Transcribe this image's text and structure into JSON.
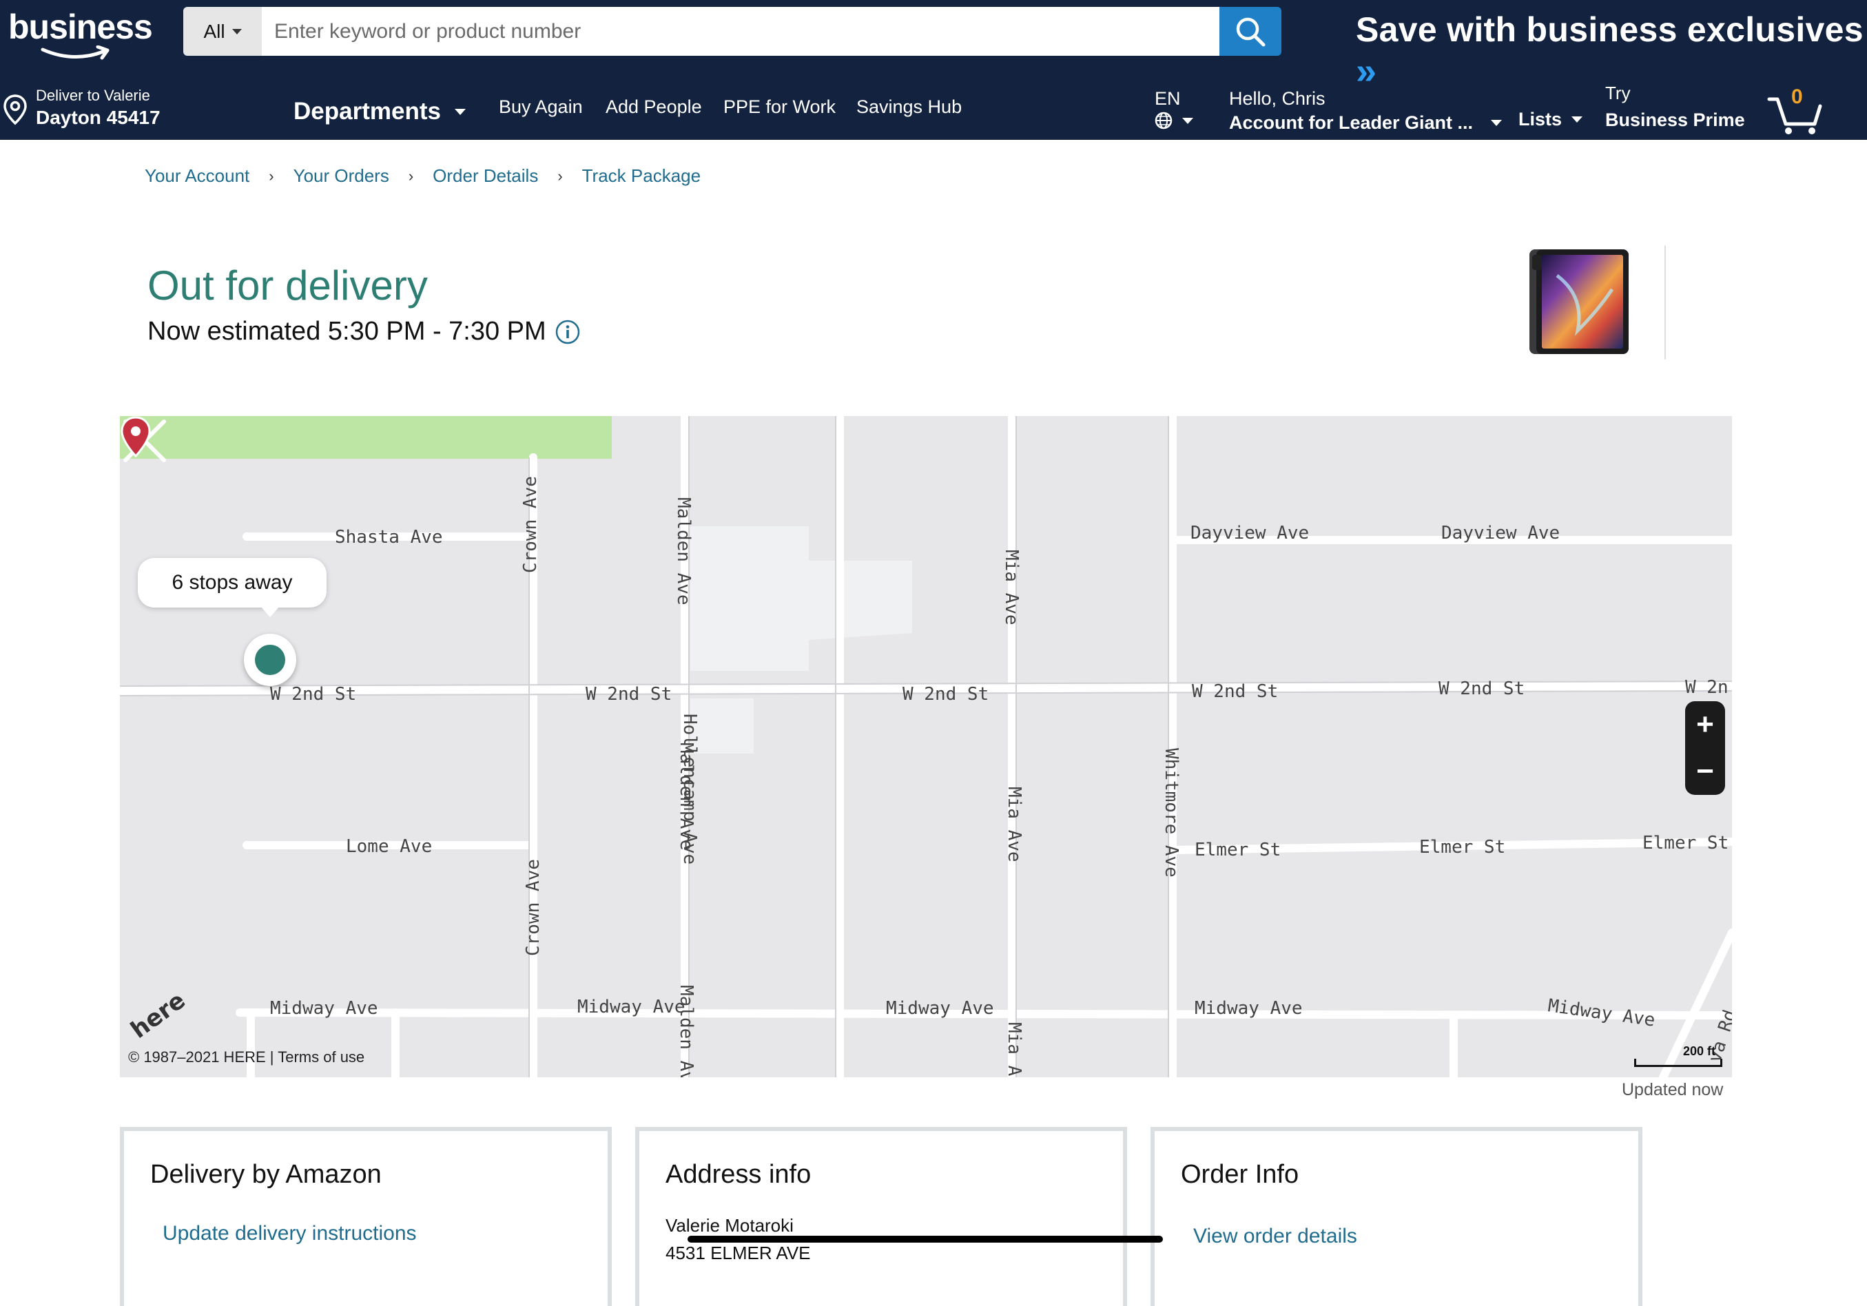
{
  "header": {
    "logo_text": "business",
    "search": {
      "category": "All",
      "placeholder": "Enter keyword or product number"
    },
    "promo_text": "Save with business exclusives",
    "promo_arrow": "»",
    "location": {
      "line1": "Deliver to Valerie",
      "line2": "Dayton 45417"
    },
    "nav": {
      "departments": "Departments",
      "buy_again": "Buy Again",
      "add_people": "Add People",
      "ppe": "PPE for Work",
      "savings": "Savings Hub"
    },
    "language": "EN",
    "account": {
      "greeting": "Hello, Chris",
      "name": "Account for Leader Giant ..."
    },
    "lists": "Lists",
    "try": {
      "line1": "Try",
      "line2": "Business Prime"
    },
    "cart_count": "0"
  },
  "breadcrumb": {
    "items": [
      "Your Account",
      "Your Orders",
      "Order Details",
      "Track Package"
    ],
    "separator": "›"
  },
  "status": {
    "title": "Out for delivery",
    "estimate": "Now estimated 5:30 PM - 7:30 PM"
  },
  "map": {
    "streets": {
      "shasta": "Shasta Ave",
      "crown": "Crown Ave",
      "malden": "Malden Ave",
      "malden_cut": "Malden Av",
      "mia": "Mia Ave",
      "mia_cut": "Mia A",
      "dayview": "Dayview Ave",
      "w2nd": "W 2nd St",
      "w2nd_cut": "W 2n",
      "hollencamp": "Hollencamp Ave",
      "whitmore": "Whitmore Ave",
      "lome": "Lome Ave",
      "elmer": "Elmer St",
      "midway": "Midway Ave",
      "rd_cut": "va Rd"
    },
    "stops_away": "6 stops away",
    "zoom_in": "+",
    "zoom_out": "−",
    "logo": "here",
    "copyright": "© 1987–2021 HERE",
    "copyright_sep": " | ",
    "terms": "Terms of use",
    "scale": "200 ft",
    "colors": {
      "driver": "#2f7f74",
      "destination_pin": "#c62f3d",
      "park": "#bde6a4"
    }
  },
  "updated": "Updated now",
  "cards": {
    "delivery": {
      "title": "Delivery by Amazon",
      "link": "Update delivery instructions"
    },
    "address": {
      "title": "Address info",
      "name": "Valerie Motaroki",
      "street": "4531 ELMER AVE"
    },
    "order": {
      "title": "Order Info",
      "link": "View order details"
    }
  }
}
